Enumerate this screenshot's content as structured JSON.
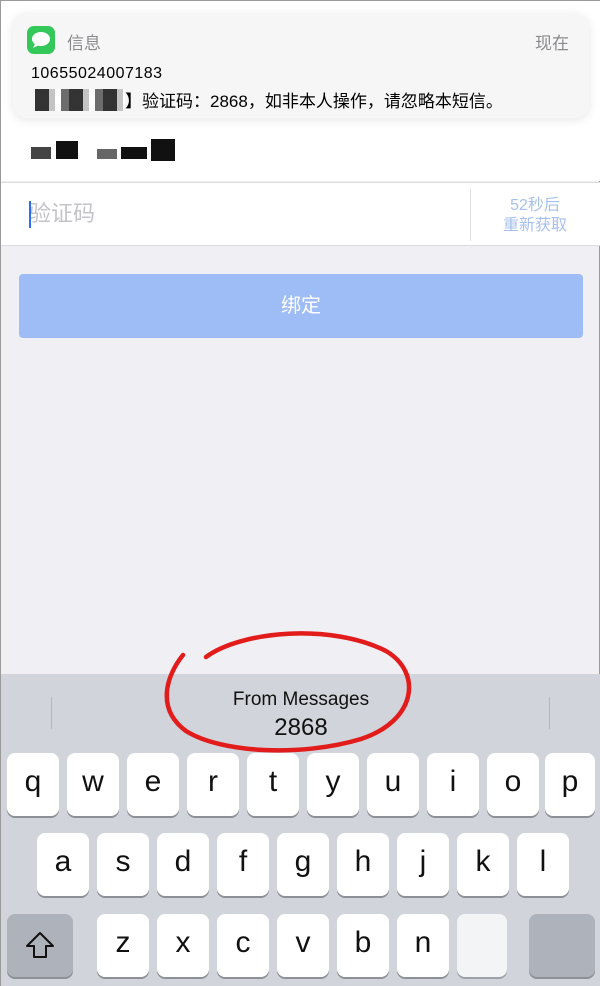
{
  "notification": {
    "app_name": "信息",
    "time": "现在",
    "sender": "10655024007183",
    "message_prefix": "【",
    "message_bracket_close": "】",
    "message": "验证码：2868，如非本人操作，请忽略本短信。"
  },
  "form": {
    "code_placeholder": "验证码",
    "resend_countdown": "52秒后",
    "resend_label": "重新获取",
    "bind_button": "绑定"
  },
  "keyboard": {
    "suggestion_source": "From Messages",
    "suggestion_code": "2868",
    "row1": [
      "q",
      "w",
      "e",
      "r",
      "t",
      "y",
      "u",
      "i",
      "o",
      "p"
    ],
    "row2": [
      "a",
      "s",
      "d",
      "f",
      "g",
      "h",
      "j",
      "k",
      "l"
    ],
    "row3": [
      "z",
      "x",
      "c",
      "v",
      "b",
      "n"
    ]
  },
  "colors": {
    "accent_button": "#9ebcf5",
    "resend_text": "#a7c0ee",
    "annotation": "#e21b1b",
    "messages_icon": "#34c759"
  }
}
